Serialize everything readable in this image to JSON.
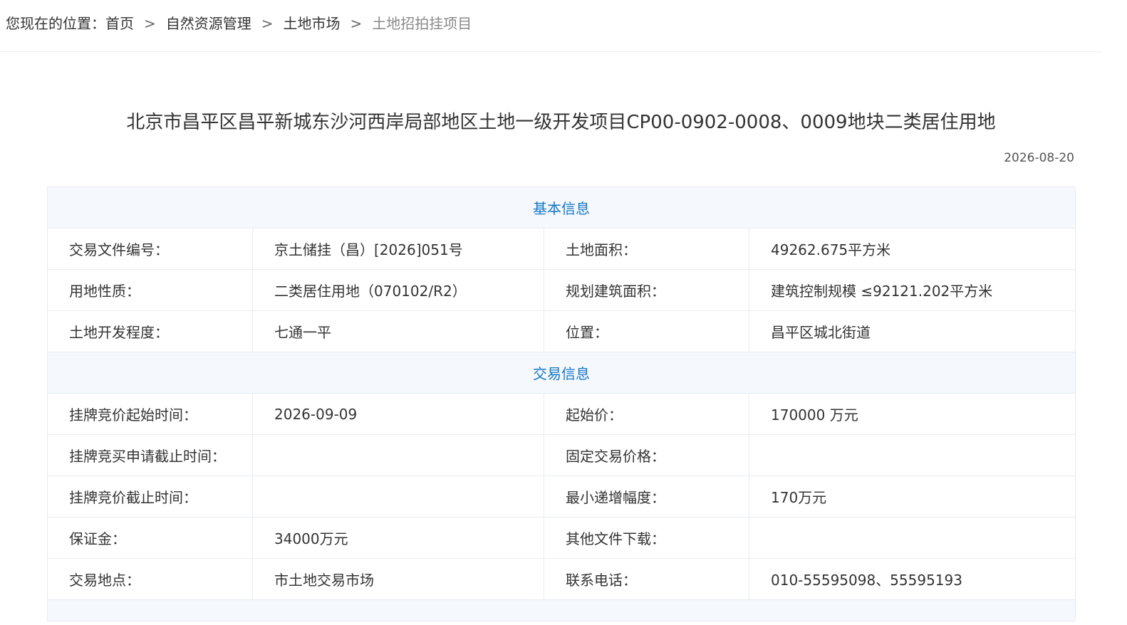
{
  "breadcrumb": {
    "prefix": "您现在的位置：",
    "items": [
      "首页",
      "自然资源管理",
      "土地市场",
      "土地招拍挂项目"
    ],
    "separator": ">"
  },
  "title": "北京市昌平区昌平新城东沙河西岸局部地区土地一级开发项目CP00-0902-0008、0009地块二类居住用地",
  "date": "2026-08-20",
  "colors": {
    "section_header_text": "#1677c7",
    "section_header_bg": "#f5f8fc",
    "border": "#e8ecf0"
  },
  "sections": {
    "basic": {
      "title": "基本信息",
      "rows": [
        [
          "交易文件编号：",
          "京土储挂（昌）[2026]051号",
          "土地面积：",
          "49262.675平方米"
        ],
        [
          "用地性质：",
          "二类居住用地（070102/R2）",
          "规划建筑面积：",
          "建筑控制规模 ≤92121.202平方米"
        ],
        [
          "土地开发程度：",
          "七通一平",
          "位置：",
          "昌平区城北街道"
        ]
      ]
    },
    "trade": {
      "title": "交易信息",
      "rows": [
        [
          "挂牌竞价起始时间：",
          "2026-09-09",
          "起始价：",
          "170000 万元"
        ],
        [
          "挂牌竞买申请截止时间：",
          "",
          "固定交易价格：",
          ""
        ],
        [
          "挂牌竞价截止时间：",
          "",
          "最小递增幅度：",
          "170万元"
        ],
        [
          "保证金：",
          "34000万元",
          "其他文件下载：",
          ""
        ],
        [
          "交易地点：",
          "市土地交易市场",
          "联系电话：",
          "010-55595098、55595193"
        ]
      ]
    }
  }
}
